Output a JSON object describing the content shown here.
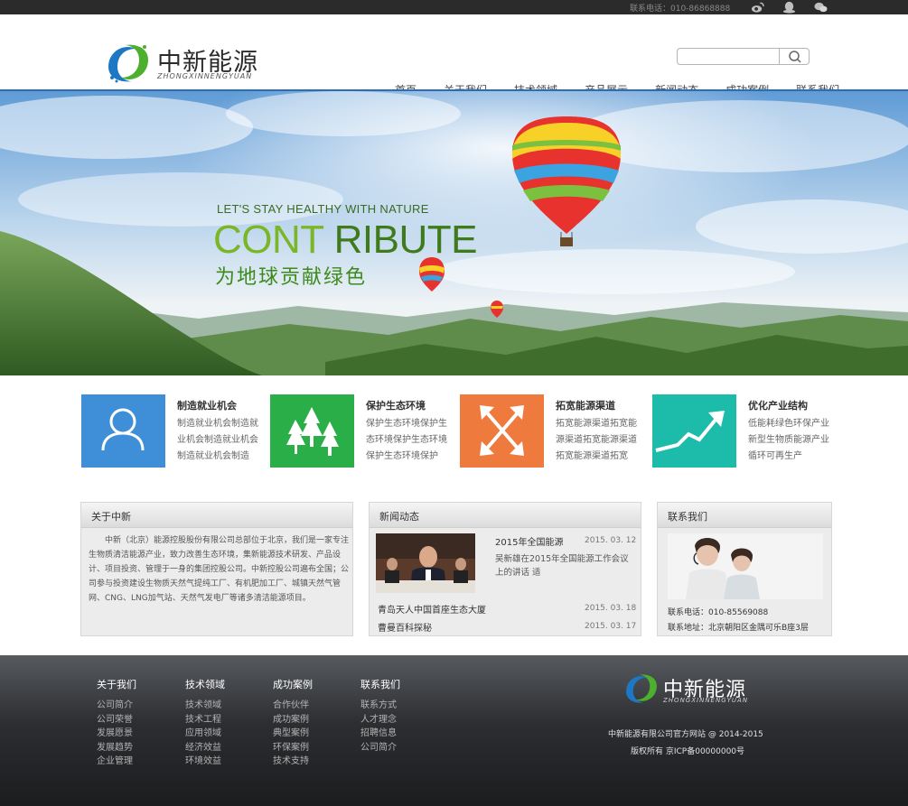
{
  "topbar": {
    "phone": "联系电话：010-86868888",
    "icons": [
      "weibo-icon",
      "qq-icon",
      "wechat-icon"
    ]
  },
  "header": {
    "logo_cn": "中新能源",
    "logo_en": "ZHONGXINNENGYUAN",
    "search_placeholder": "",
    "nav": [
      "首页",
      "关于我们",
      "技术领域",
      "产品展示",
      "新闻动态",
      "成功案例",
      "联系我们"
    ],
    "active_nav_index": 0
  },
  "banner": {
    "slogan_en": "LET'S STAY HEALTHY WITH NATURE",
    "slogan_big_1": "CONT ",
    "slogan_big_2": "RIBUTE",
    "slogan_cn": "为地球贡献绿色"
  },
  "features": [
    {
      "title": "制造就业机会",
      "desc": "制造就业机会制造就业机会制造就业机会制造就业机会制造",
      "color": "#3f8fd8",
      "icon": "user-icon"
    },
    {
      "title": "保护生态环境",
      "desc": "保护生态环境保护生态环境保护生态环境保护生态环境保护",
      "color": "#2aae47",
      "icon": "trees-icon"
    },
    {
      "title": "拓宽能源渠道",
      "desc": "拓宽能源渠道拓宽能源渠道拓宽能源渠道拓宽能源渠道拓宽",
      "color": "#ee7a3e",
      "icon": "expand-arrows-icon"
    },
    {
      "title": "优化产业结构",
      "desc": "低能耗绿色环保产业新型生物质能源产业循环可再生产",
      "color": "#1dbcaa",
      "icon": "growth-chart-icon"
    }
  ],
  "about": {
    "title": "关于中新",
    "text": "中新（北京）能源控股股份有限公司总部位于北京，我们是一家专注生物质清洁能源产业，致力改善生态环境，集新能源技术研发、产品设计、项目投资、管理于一身的集团控股公司。中新控股公司遍布全国；公司参与投资建设生物质天然气提纯工厂、有机肥加工厂、城镇天然气管网、CNG、LNG加气站、天然气发电厂等诸多清洁能源项目。"
  },
  "news": {
    "title": "新闻动态",
    "featured_title": "2015年全国能源",
    "featured_date": "2015. 03. 12",
    "featured_summary": "吴新雄在2015年全国能源工作会议上的讲话 适",
    "items": [
      {
        "title": "青岛天人中国首座生态大厦",
        "date": "2015. 03. 18"
      },
      {
        "title": "曹曼百科探秘",
        "date": "2015. 03. 17"
      }
    ]
  },
  "contact": {
    "title": "联系我们",
    "phone": "联系电话：010-85569088",
    "address": "联系地址：北京朝阳区金隅可乐B座3层"
  },
  "footer": {
    "columns": [
      {
        "head": "关于我们",
        "links": [
          "公司简介",
          "公司荣誉",
          "发展愿景",
          "发展趋势",
          "企业管理"
        ]
      },
      {
        "head": "技术领域",
        "links": [
          "技术领域",
          "技术工程",
          "应用领域",
          "经济效益",
          "环境效益"
        ]
      },
      {
        "head": "成功案例",
        "links": [
          "合作伙伴",
          "成功案例",
          "典型案例",
          "环保案例",
          "技术支持"
        ]
      },
      {
        "head": "联系我们",
        "links": [
          "联系方式",
          "人才理念",
          "招聘信息",
          "公司简介"
        ]
      }
    ],
    "logo_cn": "中新能源",
    "logo_en": "ZHONGXINNENGYUAN",
    "copyright": "中新能源有限公司官方网站 @ 2014-2015",
    "icp": "版权所有 京ICP备00000000号"
  }
}
